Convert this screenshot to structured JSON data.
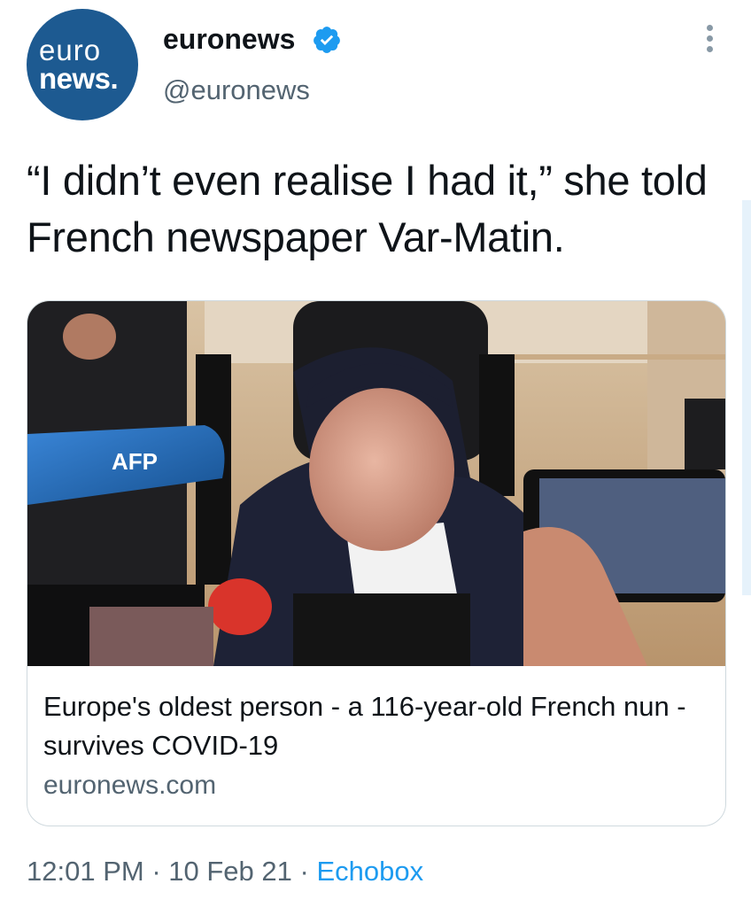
{
  "author": {
    "avatar_line1": "euro",
    "avatar_line2": "news.",
    "name": "euronews",
    "handle": "@euronews",
    "verified": true,
    "verified_icon": "verified-badge-icon",
    "brand_color": "#1d5a91"
  },
  "tweet": {
    "text": "“I didn’t even realise I had it,” she told French newspaper Var-Matin."
  },
  "card": {
    "image_microphone_logo": "AFP",
    "title": "Europe's oldest person - a 116-year-old French nun - survives COVID-19",
    "domain": "euronews.com"
  },
  "meta": {
    "time": "12:01 PM",
    "separator": " · ",
    "date": "10 Feb 21",
    "source": "Echobox",
    "source_color": "#1d9bf0"
  },
  "icons": {
    "more": "more-options-icon"
  }
}
